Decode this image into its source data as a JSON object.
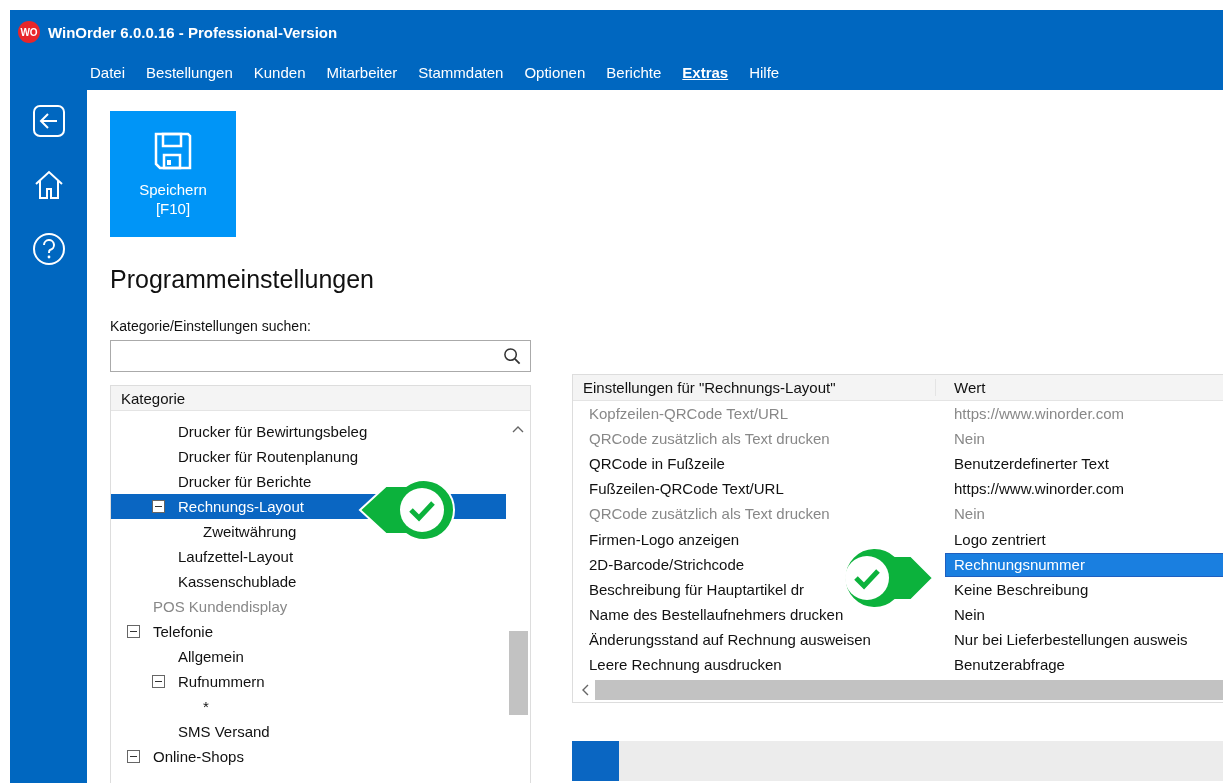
{
  "window": {
    "logo": "WO",
    "title": "WinOrder 6.0.0.16 - Professional-Version"
  },
  "menu": [
    {
      "label": "Datei",
      "selected": false
    },
    {
      "label": "Bestellungen",
      "selected": false
    },
    {
      "label": "Kunden",
      "selected": false
    },
    {
      "label": "Mitarbeiter",
      "selected": false
    },
    {
      "label": "Stammdaten",
      "selected": false
    },
    {
      "label": "Optionen",
      "selected": false
    },
    {
      "label": "Berichte",
      "selected": false
    },
    {
      "label": "Extras",
      "selected": true
    },
    {
      "label": "Hilfe",
      "selected": false
    }
  ],
  "save_button": {
    "label": "Speichern",
    "shortcut": "[F10]"
  },
  "heading": "Programmeinstellungen",
  "search": {
    "label": "Kategorie/Einstellungen suchen:"
  },
  "tree": {
    "header": "Kategorie",
    "items": [
      {
        "children": [
          {
            "label": "Drucker für Bewirtungsbeleg",
            "selected": false,
            "disabled": false
          },
          {
            "label": "Drucker für Routenplanung",
            "selected": false,
            "disabled": false
          },
          {
            "label": "Drucker für Berichte",
            "selected": false,
            "disabled": false
          },
          {
            "label": "Rechnungs-Layout",
            "selected": true,
            "disabled": false,
            "expanded": true,
            "children": [
              {
                "label": "Zweitwährung",
                "selected": false,
                "disabled": false
              }
            ]
          },
          {
            "label": "Laufzettel-Layout",
            "selected": false,
            "disabled": false
          },
          {
            "label": "Kassenschublade",
            "selected": false,
            "disabled": false
          }
        ]
      },
      {
        "label": "POS Kundendisplay",
        "selected": false,
        "disabled": true
      },
      {
        "label": "Telefonie",
        "selected": false,
        "disabled": false,
        "expanded": true,
        "children": [
          {
            "label": "Allgemein",
            "selected": false,
            "disabled": false
          },
          {
            "label": "Rufnummern",
            "selected": false,
            "disabled": false,
            "expanded": true,
            "children": [
              {
                "label": "*",
                "selected": false,
                "disabled": false
              }
            ]
          },
          {
            "label": "SMS Versand",
            "selected": false,
            "disabled": false
          }
        ]
      },
      {
        "label": "Online-Shops",
        "selected": false,
        "disabled": false,
        "expanded": true
      }
    ]
  },
  "settings": {
    "columns": [
      "Einstellungen für \"Rechnungs-Layout\"",
      "Wert"
    ],
    "rows": [
      {
        "name": "Kopfzeilen-QRCode Text/URL",
        "value": "https://www.winorder.com",
        "disabled": true,
        "selected": false
      },
      {
        "name": "QRCode zusätzlich als Text drucken",
        "value": "Nein",
        "disabled": true,
        "selected": false
      },
      {
        "name": "QRCode in Fußzeile",
        "value": "Benutzerdefinerter Text",
        "disabled": false,
        "selected": false
      },
      {
        "name": "Fußzeilen-QRCode Text/URL",
        "value": "https://www.winorder.com",
        "disabled": false,
        "selected": false
      },
      {
        "name": "QRCode zusätzlich als Text drucken",
        "value": "Nein",
        "disabled": true,
        "selected": false
      },
      {
        "name": "Firmen-Logo anzeigen",
        "value": "Logo zentriert",
        "disabled": false,
        "selected": false
      },
      {
        "name": "2D-Barcode/Strichcode",
        "value": "Rechnungsnummer",
        "disabled": false,
        "selected": true
      },
      {
        "name": "Beschreibung für Hauptartikel dr",
        "value": "Keine Beschreibung",
        "disabled": false,
        "selected": false
      },
      {
        "name": "Name des Bestellaufnehmers drucken",
        "value": "Nein",
        "disabled": false,
        "selected": false
      },
      {
        "name": "Änderungsstand auf Rechnung ausweisen",
        "value": "Nur bei Lieferbestellungen ausweis",
        "disabled": false,
        "selected": false
      },
      {
        "name": "Leere Rechnung ausdrucken",
        "value": "Benutzerabfrage",
        "disabled": false,
        "selected": false
      }
    ]
  }
}
